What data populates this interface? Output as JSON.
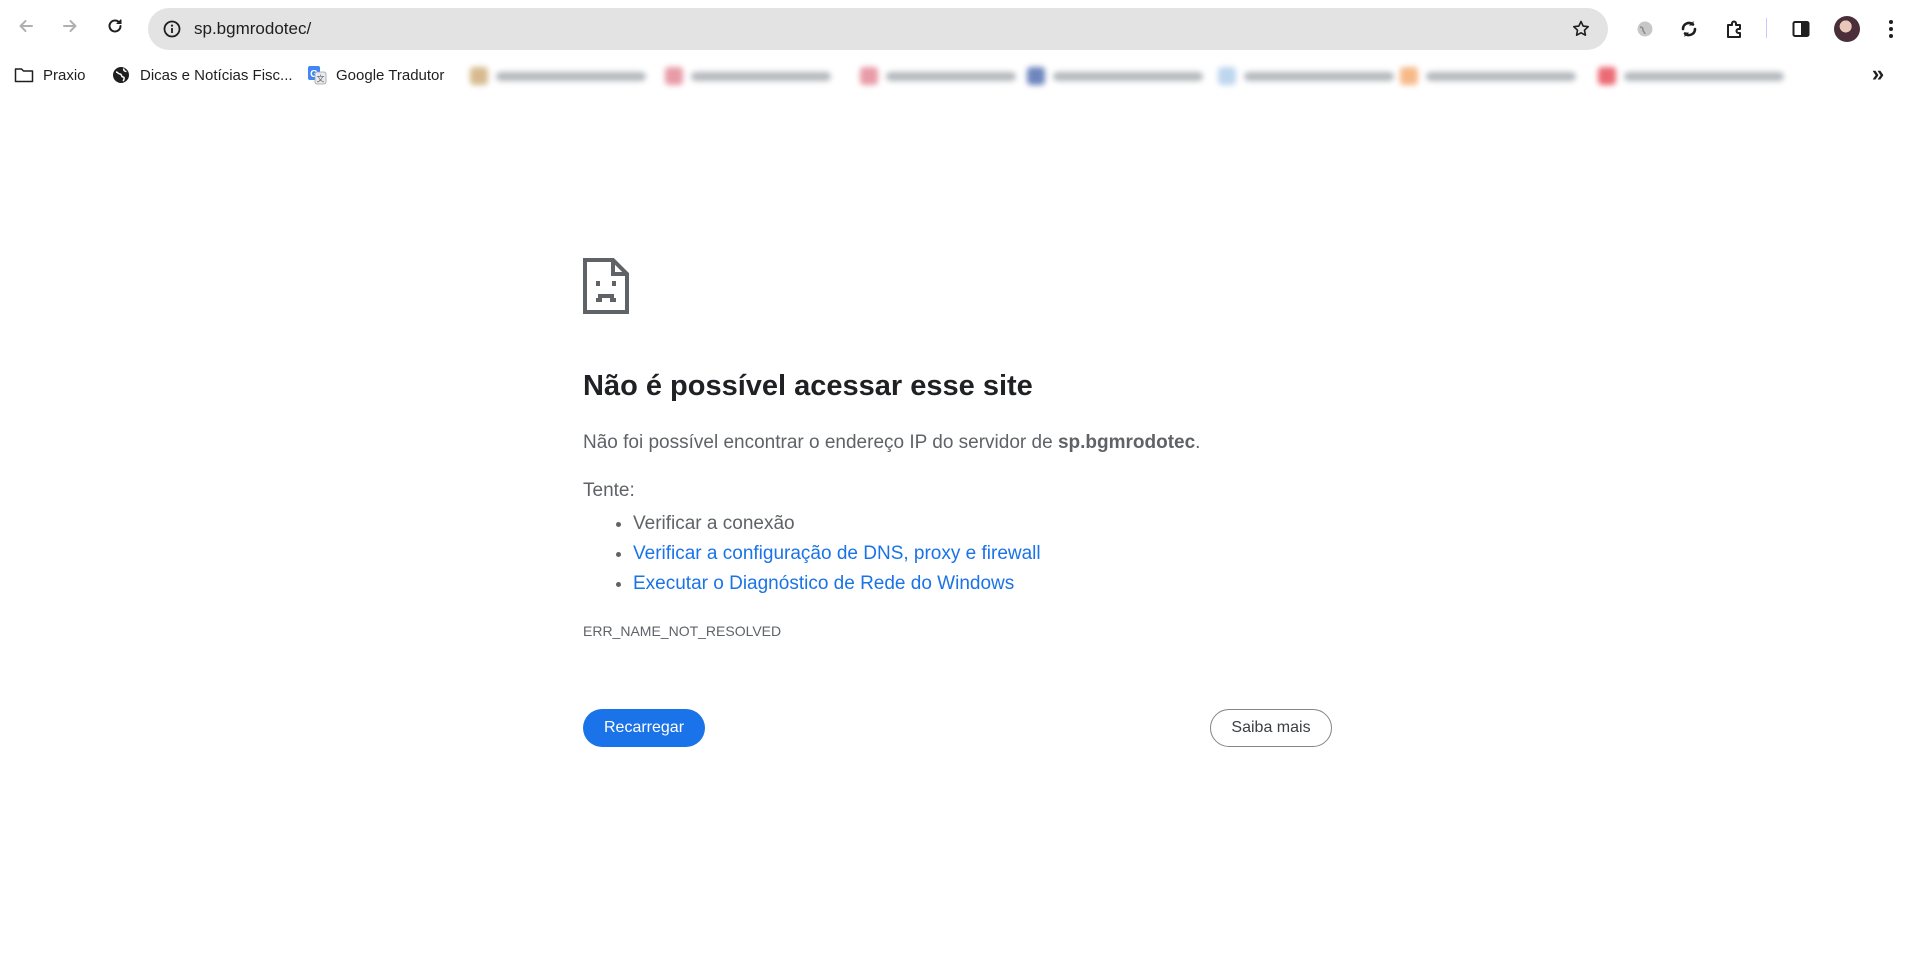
{
  "browser": {
    "address": {
      "url": "sp.bgmrodotec/"
    },
    "bookmarks": [
      {
        "label": "Praxio",
        "icon": "folder-icon"
      },
      {
        "label": "Dicas e Notícias Fisc...",
        "icon": "globe-icon"
      },
      {
        "label": "Google Tradutor",
        "icon": "google-translate-icon"
      }
    ],
    "colors": {
      "omnibox_bg": "#e3e3e3",
      "link": "#1a73e8",
      "primary_button": "#1a73e8"
    }
  },
  "error": {
    "icon": "sad-page-icon",
    "title": "Não é possível acessar esse site",
    "message_prefix": "Não foi possível encontrar o endereço IP do servidor de ",
    "host": "sp.bgmrodotec",
    "message_suffix": ".",
    "try_label": "Tente:",
    "suggestions": [
      {
        "text": "Verificar a conexão",
        "link": false
      },
      {
        "text": "Verificar a configuração de DNS, proxy e firewall",
        "link": true
      },
      {
        "text": "Executar o Diagnóstico de Rede do Windows",
        "link": true
      }
    ],
    "code": "ERR_NAME_NOT_RESOLVED",
    "reload_label": "Recarregar",
    "learn_more_label": "Saiba mais"
  }
}
